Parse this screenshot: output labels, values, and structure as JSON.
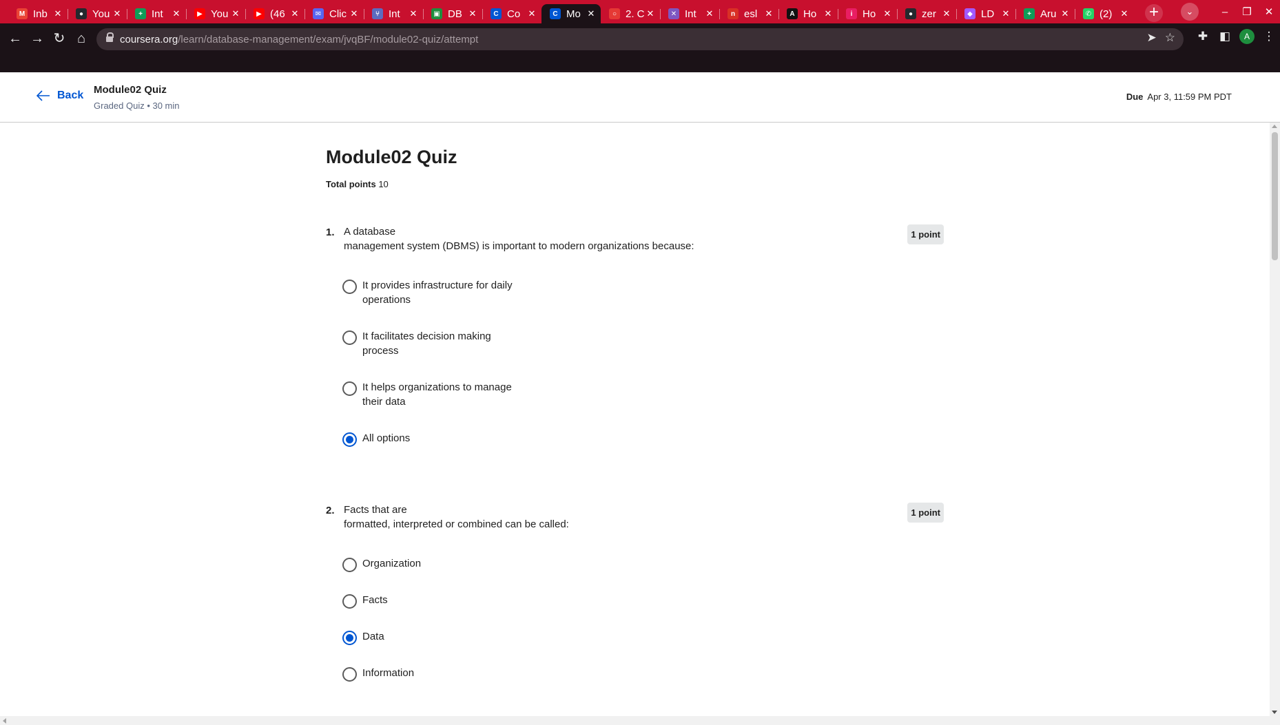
{
  "browser": {
    "tabs": [
      {
        "title": "Inb",
        "icon": "gmail-icon",
        "color": "#ea4335",
        "glyph": "M"
      },
      {
        "title": "You",
        "icon": "github-icon",
        "color": "#24292e",
        "glyph": "●"
      },
      {
        "title": "Int",
        "icon": "sheets-icon",
        "color": "#0f9d58",
        "glyph": "+"
      },
      {
        "title": "You",
        "icon": "youtube-icon",
        "color": "#ff0000",
        "glyph": "▶"
      },
      {
        "title": "(46",
        "icon": "youtube-icon",
        "color": "#ff0000",
        "glyph": "▶"
      },
      {
        "title": "Clic",
        "icon": "chat-icon",
        "color": "#5865f2",
        "glyph": "✉"
      },
      {
        "title": "Int",
        "icon": "git-icon",
        "color": "#5c6bc0",
        "glyph": "⑂"
      },
      {
        "title": "DB",
        "icon": "classroom-icon",
        "color": "#1e8e3e",
        "glyph": "▣"
      },
      {
        "title": "Co",
        "icon": "coursera-icon",
        "color": "#0056d2",
        "glyph": "C"
      },
      {
        "title": "Mo",
        "icon": "coursera-icon",
        "color": "#0056d2",
        "glyph": "C",
        "active": true
      },
      {
        "title": "2. C",
        "icon": "youtube-alt-icon",
        "color": "#e53935",
        "glyph": "○"
      },
      {
        "title": "Int",
        "icon": "puzzle-icon",
        "color": "#7e57c2",
        "glyph": "✕"
      },
      {
        "title": "esl",
        "icon": "notion-icon",
        "color": "#d93025",
        "glyph": "n"
      },
      {
        "title": "Ho",
        "icon": "app-icon",
        "color": "#111111",
        "glyph": "A"
      },
      {
        "title": "Ho",
        "icon": "info-icon",
        "color": "#e91e63",
        "glyph": "i"
      },
      {
        "title": "zer",
        "icon": "github-icon",
        "color": "#24292e",
        "glyph": "●"
      },
      {
        "title": "LD",
        "icon": "figma-icon",
        "color": "#a259ff",
        "glyph": "◆"
      },
      {
        "title": "Aru",
        "icon": "sheets-icon",
        "color": "#0f9d58",
        "glyph": "+"
      },
      {
        "title": "(2)",
        "icon": "whatsapp-icon",
        "color": "#25d366",
        "glyph": "✆"
      }
    ],
    "url_host": "coursera.org",
    "url_path": "/learn/database-management/exam/jvqBF/module02-quiz/attempt",
    "profile_initial": "A"
  },
  "header": {
    "back_label": "Back",
    "title": "Module02 Quiz",
    "subtitle": "Graded Quiz • 30 min",
    "due_label": "Due",
    "due_value": "Apr 3, 11:59 PM PDT"
  },
  "quiz": {
    "title": "Module02 Quiz",
    "total_points_label": "Total points",
    "total_points_value": "10",
    "questions": [
      {
        "number": "1.",
        "text_line1": "A database",
        "text_line2": "management system (DBMS) is important to modern organizations because:",
        "points": "1 point",
        "options": [
          {
            "label": "It provides infrastructure for daily operations",
            "selected": false
          },
          {
            "label": "It facilitates decision making process",
            "selected": false
          },
          {
            "label": "It helps organizations to manage their data",
            "selected": false
          },
          {
            "label": "All options",
            "selected": true
          }
        ]
      },
      {
        "number": "2.",
        "text_line1": "Facts that are",
        "text_line2": "formatted, interpreted or combined can be called:",
        "points": "1 point",
        "options": [
          {
            "label": "Organization",
            "selected": false
          },
          {
            "label": "Facts",
            "selected": false
          },
          {
            "label": "Data",
            "selected": true
          },
          {
            "label": "Information",
            "selected": false
          }
        ]
      }
    ]
  },
  "colors": {
    "accent": "#0056d2",
    "tabstrip": "#c8102e",
    "toolbar": "#1b1217"
  }
}
